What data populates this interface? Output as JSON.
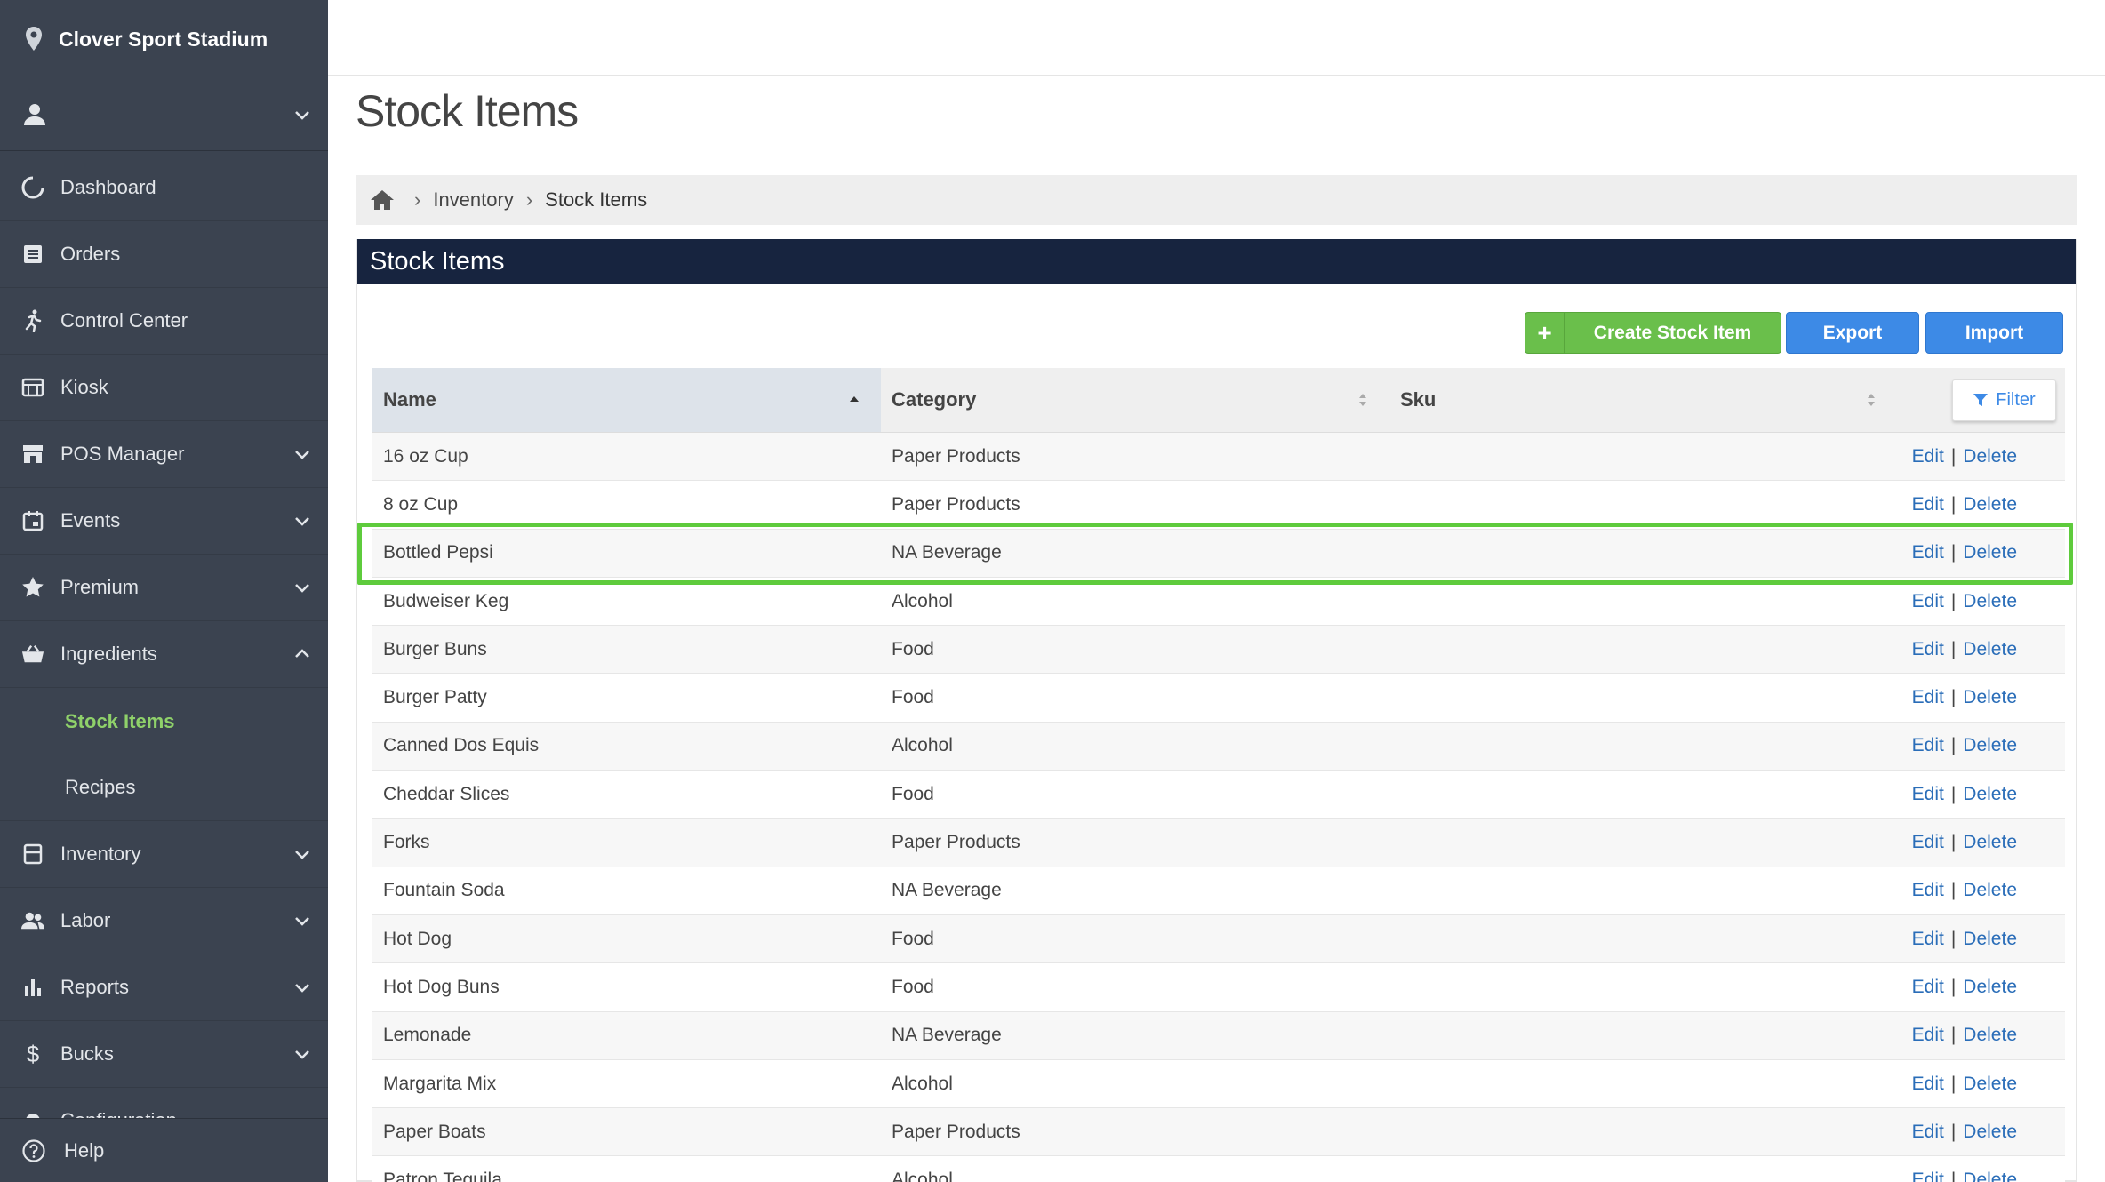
{
  "sidebar": {
    "venue": "Clover Sport Stadium",
    "items": [
      {
        "label": "Dashboard"
      },
      {
        "label": "Orders"
      },
      {
        "label": "Control Center"
      },
      {
        "label": "Kiosk"
      },
      {
        "label": "POS Manager"
      },
      {
        "label": "Events"
      },
      {
        "label": "Premium"
      },
      {
        "label": "Ingredients"
      },
      {
        "label": "Inventory"
      },
      {
        "label": "Labor"
      },
      {
        "label": "Reports"
      },
      {
        "label": "Bucks"
      },
      {
        "label": "Configuration"
      }
    ],
    "subitems": [
      {
        "label": "Stock Items"
      },
      {
        "label": "Recipes"
      }
    ],
    "help": "Help",
    "accent_color": "#8fd16a"
  },
  "page": {
    "title": "Stock Items"
  },
  "breadcrumb": {
    "items": [
      "Inventory",
      "Stock Items"
    ]
  },
  "panel": {
    "title": "Stock Items",
    "buttons": {
      "create": "Create Stock Item",
      "export": "Export",
      "import": "Import"
    }
  },
  "table": {
    "columns": [
      "Name",
      "Category",
      "Sku"
    ],
    "filter_label": "Filter",
    "action_edit": "Edit",
    "action_sep": "|",
    "action_delete": "Delete",
    "rows": [
      {
        "name": "16 oz Cup",
        "category": "Paper Products",
        "sku": ""
      },
      {
        "name": "8 oz Cup",
        "category": "Paper Products",
        "sku": ""
      },
      {
        "name": "Bottled Pepsi",
        "category": "NA Beverage",
        "sku": ""
      },
      {
        "name": "Budweiser Keg",
        "category": "Alcohol",
        "sku": ""
      },
      {
        "name": "Burger Buns",
        "category": "Food",
        "sku": ""
      },
      {
        "name": "Burger Patty",
        "category": "Food",
        "sku": ""
      },
      {
        "name": "Canned Dos Equis",
        "category": "Alcohol",
        "sku": ""
      },
      {
        "name": "Cheddar Slices",
        "category": "Food",
        "sku": ""
      },
      {
        "name": "Forks",
        "category": "Paper Products",
        "sku": ""
      },
      {
        "name": "Fountain Soda",
        "category": "NA Beverage",
        "sku": ""
      },
      {
        "name": "Hot Dog",
        "category": "Food",
        "sku": ""
      },
      {
        "name": "Hot Dog Buns",
        "category": "Food",
        "sku": ""
      },
      {
        "name": "Lemonade",
        "category": "NA Beverage",
        "sku": ""
      },
      {
        "name": "Margarita Mix",
        "category": "Alcohol",
        "sku": ""
      },
      {
        "name": "Paper Boats",
        "category": "Paper Products",
        "sku": ""
      },
      {
        "name": "Patron Tequila",
        "category": "Alcohol",
        "sku": ""
      }
    ]
  }
}
